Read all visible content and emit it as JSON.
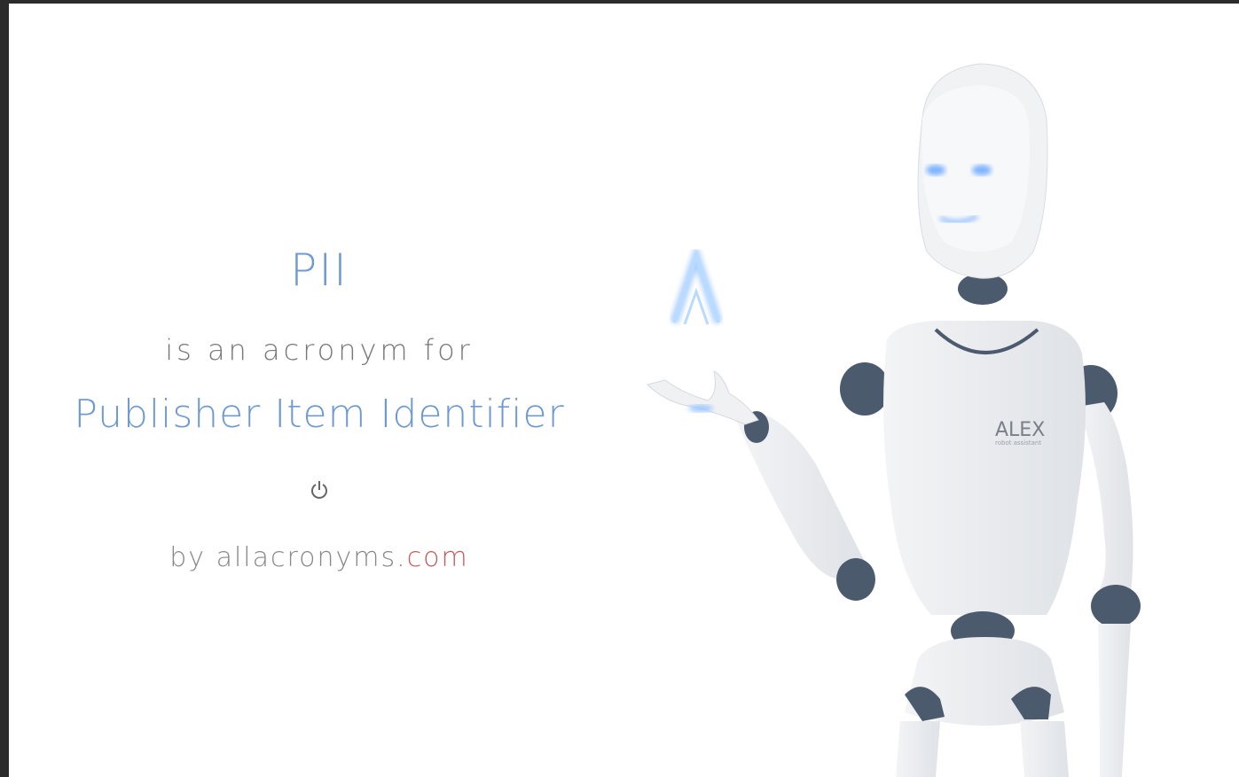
{
  "acronym": "PII",
  "connector": "is an acronym for",
  "expansion": "Publisher Item Identifier",
  "icons": {
    "power": "power-icon",
    "hologram": "chevron-up-icon"
  },
  "byline": {
    "prefix": "by ",
    "site": "allacronyms",
    "tld": ".com"
  },
  "robot": {
    "badge_name": "ALEX",
    "badge_sub": "robot assistant"
  },
  "colors": {
    "accent": "#6f9ad0",
    "tld": "#c45a5a",
    "text": "#777777",
    "frame": "#2b2b2b"
  }
}
